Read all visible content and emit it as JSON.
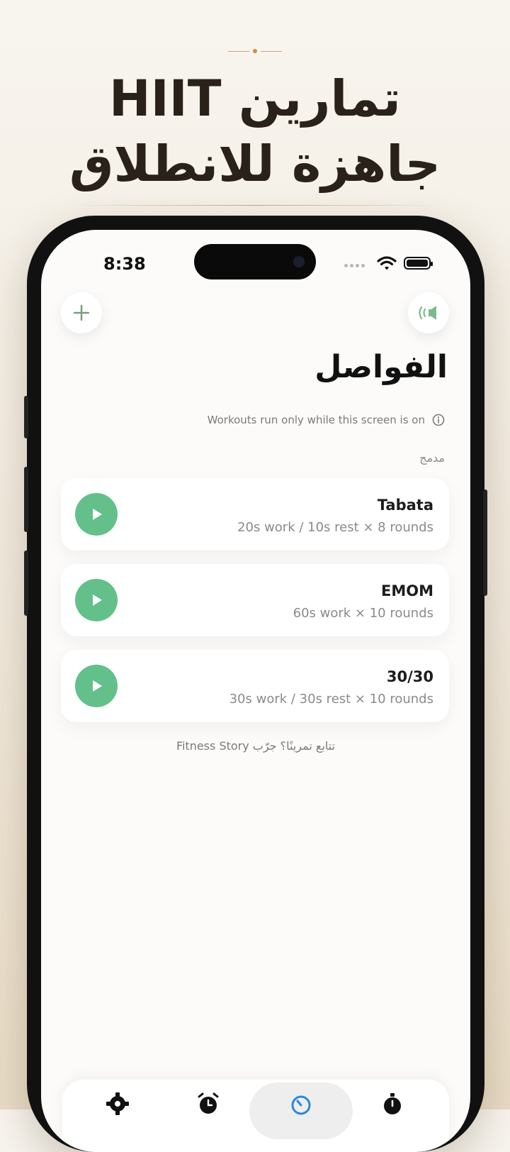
{
  "promo": {
    "headline_line1": "تمارين HIIT",
    "headline_line2": "جاهزة للانطلاق"
  },
  "status_bar": {
    "time": "8:38"
  },
  "header": {
    "title": "الفواصل",
    "notice": "Workouts run only while this screen is on"
  },
  "section": {
    "label": "مدمج"
  },
  "workouts": [
    {
      "name": "Tabata",
      "description": "20s work / 10s rest × 8 rounds"
    },
    {
      "name": "EMOM",
      "description": "60s work × 10 rounds"
    },
    {
      "name": "30/30",
      "description": "30s work / 30s rest × 10 rounds"
    }
  ],
  "footer_promo": "تتابع تمرينًا؟ جرّب Fitness Story",
  "tabbar": {
    "tabs": [
      {
        "icon": "gear-icon"
      },
      {
        "icon": "alarm-icon"
      },
      {
        "icon": "timer-icon",
        "active": true
      },
      {
        "icon": "stopwatch-icon"
      }
    ]
  },
  "colors": {
    "accent_green": "#63c08a",
    "active_blue": "#2e86de",
    "headline": "#2a221a"
  }
}
